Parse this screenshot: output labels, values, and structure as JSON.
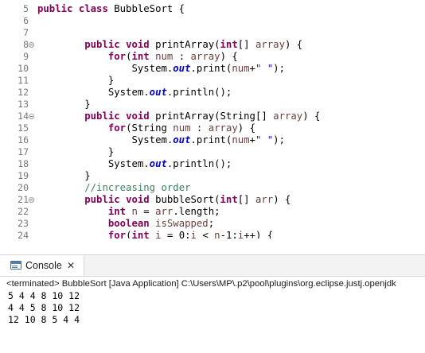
{
  "editor": {
    "line_numbers": [
      "5",
      "6",
      "7",
      "8",
      "9",
      "10",
      "11",
      "12",
      "13",
      "14",
      "15",
      "16",
      "17",
      "18",
      "19",
      "20",
      "21",
      "22",
      "23",
      "24"
    ],
    "fold_markers": [
      "8",
      "14",
      "21"
    ],
    "lines": [
      [
        [
          "kw",
          "public "
        ],
        [
          "kw",
          "class "
        ],
        [
          "",
          "BubbleSort {"
        ]
      ],
      [],
      [],
      [
        [
          "",
          "        "
        ],
        [
          "kw",
          "public "
        ],
        [
          "kw",
          "void "
        ],
        [
          "",
          "printArray("
        ],
        [
          "kw",
          "int"
        ],
        [
          "",
          "[] "
        ],
        [
          "prm",
          "array"
        ],
        [
          "",
          ") {"
        ]
      ],
      [
        [
          "",
          "            "
        ],
        [
          "kw",
          "for"
        ],
        [
          "",
          "("
        ],
        [
          "kw",
          "int "
        ],
        [
          "lv",
          "num"
        ],
        [
          "",
          " : "
        ],
        [
          "prm",
          "array"
        ],
        [
          "",
          ") {"
        ]
      ],
      [
        [
          "",
          "                System."
        ],
        [
          "fld",
          "out"
        ],
        [
          "",
          ".print("
        ],
        [
          "lv",
          "num"
        ],
        [
          "",
          "+"
        ],
        [
          "str",
          "\" \""
        ],
        [
          "",
          ");"
        ]
      ],
      [
        [
          "",
          "            }"
        ]
      ],
      [
        [
          "",
          "            System."
        ],
        [
          "fld",
          "out"
        ],
        [
          "",
          ".println();"
        ]
      ],
      [
        [
          "",
          "        }"
        ]
      ],
      [
        [
          "",
          "        "
        ],
        [
          "kw",
          "public "
        ],
        [
          "kw",
          "void "
        ],
        [
          "",
          "printArray(String[] "
        ],
        [
          "prm",
          "array"
        ],
        [
          "",
          ") {"
        ]
      ],
      [
        [
          "",
          "            "
        ],
        [
          "kw",
          "for"
        ],
        [
          "",
          "(String "
        ],
        [
          "lv",
          "num"
        ],
        [
          "",
          " : "
        ],
        [
          "prm",
          "array"
        ],
        [
          "",
          ") {"
        ]
      ],
      [
        [
          "",
          "                System."
        ],
        [
          "fld",
          "out"
        ],
        [
          "",
          ".print("
        ],
        [
          "lv",
          "num"
        ],
        [
          "",
          "+"
        ],
        [
          "str",
          "\" \""
        ],
        [
          "",
          ");"
        ]
      ],
      [
        [
          "",
          "            }"
        ]
      ],
      [
        [
          "",
          "            System."
        ],
        [
          "fld",
          "out"
        ],
        [
          "",
          ".println();"
        ]
      ],
      [
        [
          "",
          "        }"
        ]
      ],
      [
        [
          "",
          "        "
        ],
        [
          "cmt",
          "//increasing order"
        ]
      ],
      [
        [
          "",
          "        "
        ],
        [
          "kw",
          "public "
        ],
        [
          "kw",
          "void "
        ],
        [
          "",
          "bubbleSort("
        ],
        [
          "kw",
          "int"
        ],
        [
          "",
          "[] "
        ],
        [
          "prm",
          "arr"
        ],
        [
          "",
          ") {"
        ]
      ],
      [
        [
          "",
          "            "
        ],
        [
          "kw",
          "int "
        ],
        [
          "lv",
          "n"
        ],
        [
          "",
          " = "
        ],
        [
          "prm",
          "arr"
        ],
        [
          "",
          ".length;"
        ]
      ],
      [
        [
          "",
          "            "
        ],
        [
          "kw",
          "boolean "
        ],
        [
          "lv",
          "isSwapped"
        ],
        [
          "",
          ";"
        ]
      ],
      [
        [
          "",
          "            "
        ],
        [
          "kw",
          "for"
        ],
        [
          "",
          "("
        ],
        [
          "kw",
          "int "
        ],
        [
          "lv",
          "i"
        ],
        [
          "",
          " = 0;"
        ],
        [
          "lv",
          "i"
        ],
        [
          "",
          " < "
        ],
        [
          "lv",
          "n"
        ],
        [
          "",
          "-1;"
        ],
        [
          "lv",
          "i"
        ],
        [
          "",
          "++) {"
        ]
      ]
    ]
  },
  "scrollbar": {
    "left_arrow": "<"
  },
  "console": {
    "tab_label": "Console",
    "close_glyph": "✕",
    "icon": "console-icon",
    "terminated_text": "<terminated> BubbleSort [Java Application] C:\\Users\\MP\\.p2\\pool\\plugins\\org.eclipse.justj.openjdk",
    "output_lines": [
      "5 4 4 8 10 12",
      "4 4 5 8 10 12",
      "12 10 8 5 4 4"
    ]
  },
  "colors": {
    "keyword": "#7f0055",
    "field": "#0000c0",
    "variable": "#6a3e3e",
    "string": "#2a00ff",
    "comment": "#3f7f5f"
  }
}
